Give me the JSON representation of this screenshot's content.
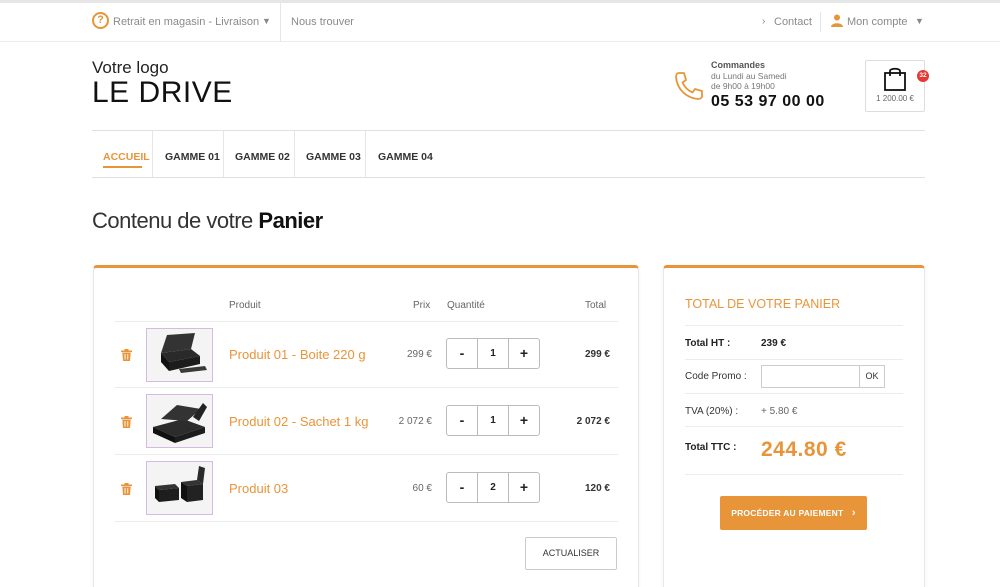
{
  "topbar": {
    "pickup_label": "Retrait en magasin - Livraison",
    "find_us": "Nous trouver",
    "contact": "Contact",
    "account": "Mon compte"
  },
  "header": {
    "logo_small": "Votre logo",
    "logo_big": "LE DRIVE",
    "orders_title": "Commandes",
    "orders_line1": "du Lundi au Samedi",
    "orders_line2": "de 9h00 à 19h00",
    "phone": "05 53 97 00 00",
    "cart_badge": "32",
    "cart_amount": "1 200.00 €"
  },
  "nav": {
    "items": [
      "ACCUEIL",
      "GAMME 01",
      "GAMME 02",
      "GAMME 03",
      "GAMME 04"
    ]
  },
  "page": {
    "title_prefix": "Contenu de votre",
    "title_bold": "Panier"
  },
  "cart": {
    "headers": {
      "product": "Produit",
      "price": "Prix",
      "quantity": "Quantité",
      "total": "Total"
    },
    "rows": [
      {
        "name": "Produit 01 - Boite 220 g",
        "price": "299 €",
        "qty": "1",
        "total": "299 €"
      },
      {
        "name": "Produit 02 - Sachet 1 kg",
        "price": "2 072 €",
        "qty": "1",
        "total": "2 072 €"
      },
      {
        "name": "Produit 03",
        "price": "60 €",
        "qty": "2",
        "total": "120 €"
      }
    ],
    "minus": "-",
    "plus": "+",
    "update_button": "ACTUALISER"
  },
  "summary": {
    "title": "TOTAL DE VOTRE PANIER",
    "ht_label": "Total HT :",
    "ht_value": "239 €",
    "promo_label": "Code Promo :",
    "promo_button": "OK",
    "tva_label": "TVA (20%) :",
    "tva_value": "+ 5.80 €",
    "ttc_label": "Total TTC :",
    "ttc_value": "244.80 €",
    "pay_button": "PROCÉDER AU PAIEMENT"
  },
  "colors": {
    "accent": "#e8953a",
    "badge": "#e53935"
  },
  "icons": [
    "help-icon",
    "chevron-down-icon",
    "chevron-right-icon",
    "user-icon",
    "phone-icon",
    "shopping-bag-icon",
    "trash-icon"
  ]
}
